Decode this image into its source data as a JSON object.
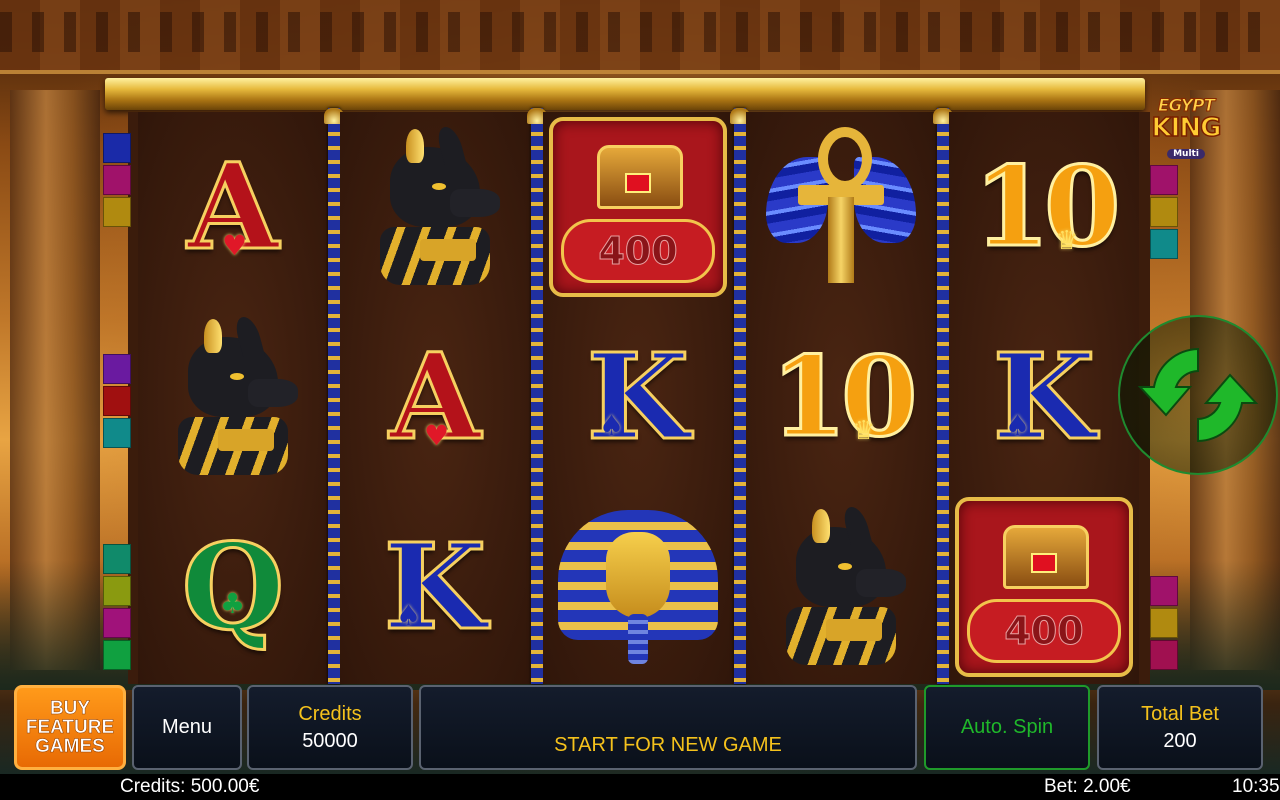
{
  "game": {
    "logo_line1": "EGYPT",
    "logo_line2": "KING",
    "logo_line3": "Multi"
  },
  "reels": {
    "columns": [
      [
        "A",
        "anubis-icon",
        "Q"
      ],
      [
        "anubis-icon",
        "A",
        "K"
      ],
      [
        "chest-400",
        "K",
        "pharaoh-icon"
      ],
      [
        "ankh-icon",
        "10",
        "anubis-icon"
      ],
      [
        "10",
        "K",
        "chest-400"
      ]
    ],
    "chest_value": "400",
    "card_labels": {
      "ace": "A",
      "king": "K",
      "queen": "Q",
      "ten": "10"
    }
  },
  "side_indicators": {
    "left_colors": [
      "#1a2aa8",
      "#a0126a",
      "#b08a10",
      "#6a1aa0",
      "#a01010",
      "#108a8a",
      "#108a6a",
      "#8a9a10",
      "#a0127a",
      "#10a040"
    ],
    "right_colors": [
      "#a0126a",
      "#b08a10",
      "#108a8a",
      "#a0126a",
      "#b08a10",
      "#a01050",
      "#1a8a30"
    ]
  },
  "controls": {
    "buy_feature": [
      "BUY",
      "FEATURE",
      "GAMES"
    ],
    "menu_label": "Menu",
    "credits_label": "Credits",
    "credits_value": "50000",
    "start_label": "START FOR NEW GAME",
    "autospin_label": "Auto. Spin",
    "total_bet_label": "Total Bet",
    "total_bet_value": "200",
    "spin_icon": "refresh-arrows-icon",
    "accent_green": "#1fb82a",
    "accent_yellow": "#f5c21c"
  },
  "status_bar": {
    "credits": "Credits: 500.00€",
    "bet": "Bet: 2.00€",
    "time": "10:35"
  }
}
